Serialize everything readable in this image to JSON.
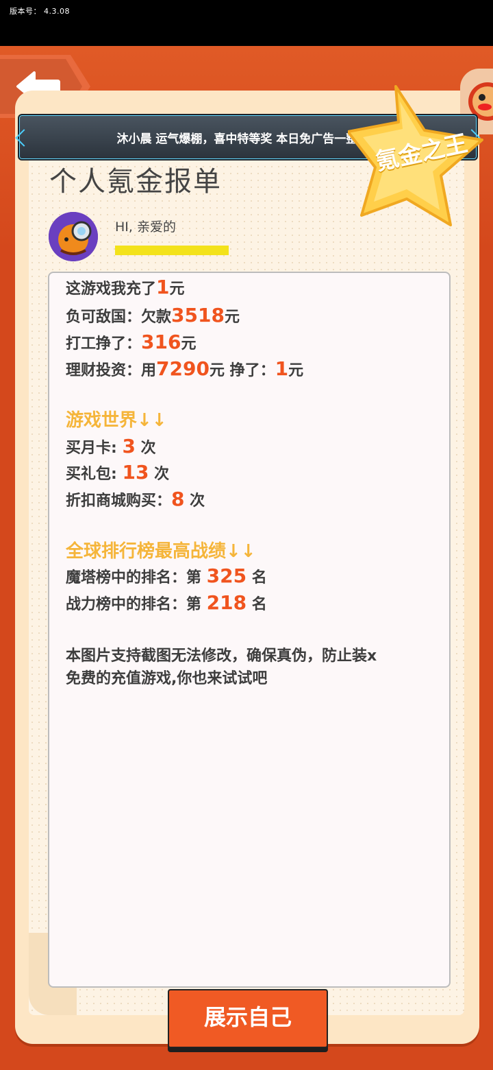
{
  "status_bar": {
    "version_label": "版本号：",
    "version": "4.3.08"
  },
  "banner": {
    "text": "沐小晨 运气爆棚，喜中特等奖 本日免广告一整天~"
  },
  "badge": {
    "text": "氪金之王"
  },
  "title": "个人氪金报单",
  "greeting": "HI, 亲爱的",
  "report": {
    "recharge": {
      "prefix": "这游戏我充了",
      "value": "1",
      "suffix": "元"
    },
    "debt": {
      "prefix": "负可敌国：欠款",
      "value": "3518",
      "suffix": "元"
    },
    "work": {
      "prefix": "打工挣了：",
      "value": "316",
      "suffix": "元"
    },
    "invest": {
      "prefix": "理财投资：用",
      "value": "7290",
      "mid": "元  挣了：",
      "value2": "1",
      "suffix": "元"
    }
  },
  "game_world": {
    "heading": "游戏世界↓↓",
    "monthly_card": {
      "prefix": "买月卡: ",
      "value": "3",
      "suffix": " 次"
    },
    "gift_pack": {
      "prefix": "买礼包: ",
      "value": "13",
      "suffix": " 次"
    },
    "discount": {
      "prefix": "折扣商城购买：",
      "value": "8",
      "suffix": " 次"
    }
  },
  "ranking": {
    "heading": "全球排行榜最高战绩↓↓",
    "tower": {
      "prefix": "魔塔榜中的排名：第 ",
      "value": "325",
      "suffix": " 名"
    },
    "power": {
      "prefix": "战力榜中的排名：第 ",
      "value": "218",
      "suffix": " 名"
    }
  },
  "disclaimer": {
    "line1": "本图片支持截图无法修改，确保真伪，防止装x",
    "line2": "免费的充值游戏,你也来试试吧"
  },
  "show_button": "展示自己",
  "colors": {
    "accent": "#f0541e",
    "section": "#f5b53a",
    "background": "#d4481c"
  }
}
